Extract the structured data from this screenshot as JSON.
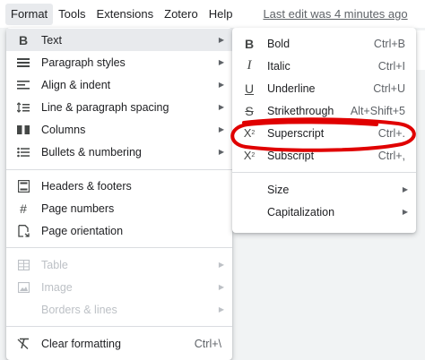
{
  "menubar": {
    "items": [
      "Format",
      "Tools",
      "Extensions",
      "Zotero",
      "Help"
    ],
    "last_edit": "Last edit was 4 minutes ago"
  },
  "format_menu": {
    "text": "Text",
    "paragraph_styles": "Paragraph styles",
    "align_indent": "Align & indent",
    "line_spacing": "Line & paragraph spacing",
    "columns": "Columns",
    "bullets": "Bullets & numbering",
    "headers_footers": "Headers & footers",
    "page_numbers": "Page numbers",
    "page_orientation": "Page orientation",
    "table": "Table",
    "image": "Image",
    "borders_lines": "Borders & lines",
    "clear_formatting": "Clear formatting",
    "clear_formatting_shortcut": "Ctrl+\\"
  },
  "text_menu": {
    "bold": "Bold",
    "bold_shortcut": "Ctrl+B",
    "italic": "Italic",
    "italic_shortcut": "Ctrl+I",
    "underline": "Underline",
    "underline_shortcut": "Ctrl+U",
    "strikethrough": "Strikethrough",
    "strikethrough_shortcut": "Alt+Shift+5",
    "superscript": "Superscript",
    "superscript_shortcut": "Ctrl+.",
    "subscript": "Subscript",
    "subscript_shortcut": "Ctrl+,",
    "size": "Size",
    "capitalization": "Capitalization"
  },
  "annotation_color": "#e00000"
}
